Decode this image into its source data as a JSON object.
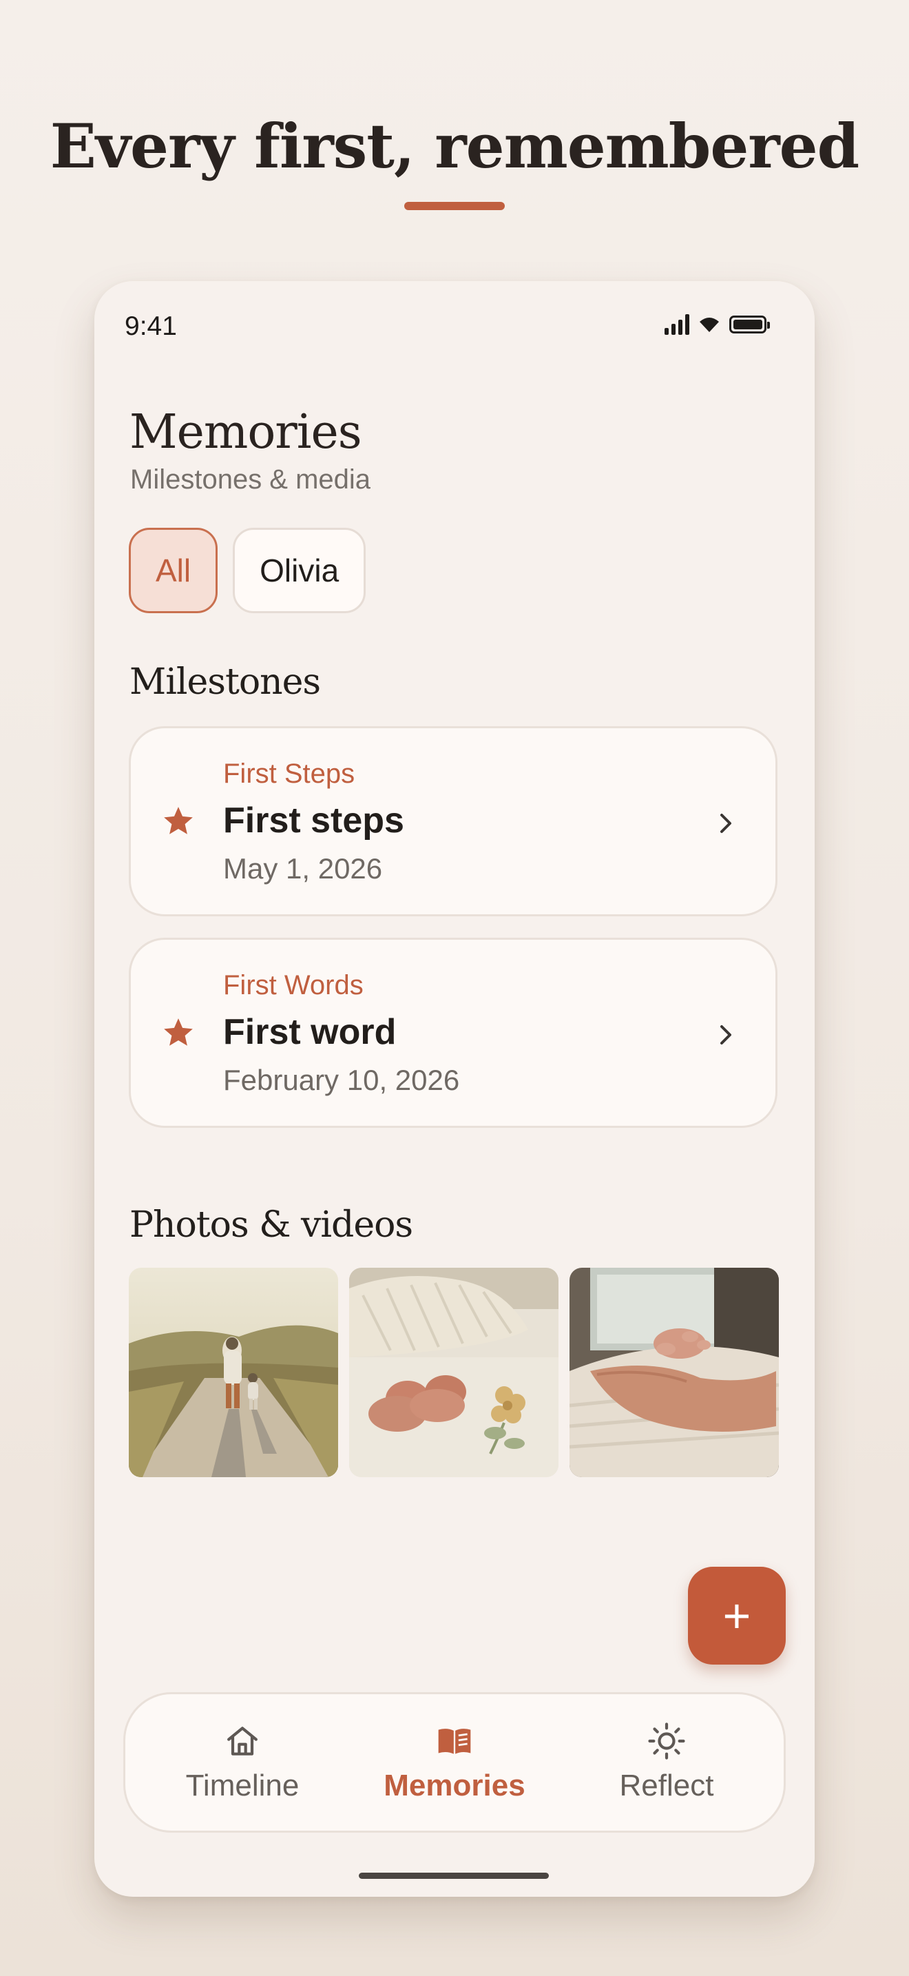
{
  "headline": "Every first, remembered",
  "status_bar": {
    "time": "9:41"
  },
  "header": {
    "title": "Memories",
    "subtitle": "Milestones & media"
  },
  "filters": [
    {
      "label": "All",
      "active": true
    },
    {
      "label": "Olivia",
      "active": false
    }
  ],
  "milestones": {
    "title": "Milestones",
    "items": [
      {
        "category": "First Steps",
        "title": "First steps",
        "date": "May 1, 2026"
      },
      {
        "category": "First Words",
        "title": "First word",
        "date": "February 10, 2026"
      }
    ]
  },
  "photos": {
    "title": "Photos & videos",
    "items": [
      {
        "name": "photo-parent-child-walking"
      },
      {
        "name": "photo-knit-booties"
      },
      {
        "name": "photo-baby-hand"
      }
    ]
  },
  "fab": {
    "label": "+"
  },
  "tabbar": {
    "items": [
      {
        "label": "Timeline",
        "icon": "home-icon",
        "active": false
      },
      {
        "label": "Memories",
        "icon": "book-icon",
        "active": true
      },
      {
        "label": "Reflect",
        "icon": "sun-icon",
        "active": false
      }
    ]
  },
  "colors": {
    "accent": "#c05f3f",
    "background": "#f7f1ed",
    "card": "#fdf9f6"
  }
}
